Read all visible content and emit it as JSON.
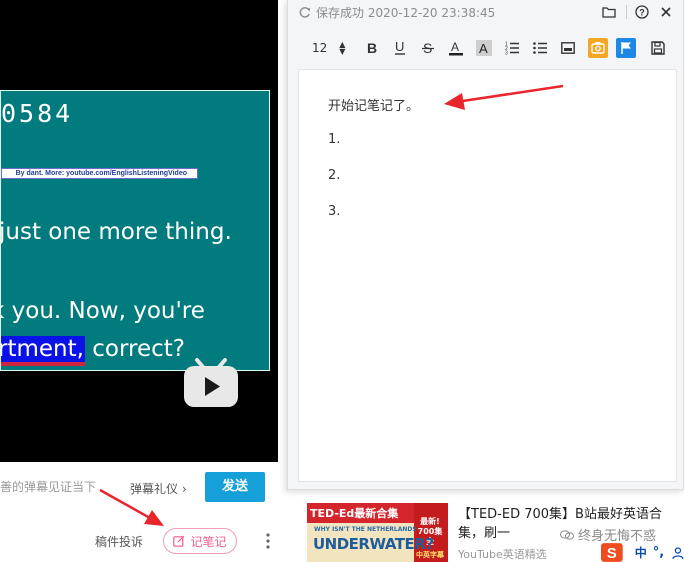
{
  "video": {
    "number": "0584",
    "credit": "By dant. More: youtube.com/EnglishListeningVideo",
    "line1": "just one more thing.",
    "line2": "k you. Now, you're",
    "line3_highlight": "rtment,",
    "line3_rest": "correct?"
  },
  "danmaku": {
    "placeholder": "善的弹幕见证当下",
    "etiquette": "弹幕礼仪",
    "send": "发送"
  },
  "toolbar": {
    "report": "稿件投诉",
    "note": "记笔记"
  },
  "note_panel": {
    "save_status": "保存成功 2020-12-20 23:38:45",
    "font_size": "12",
    "first_line": "开始记笔记了。",
    "list": [
      "1.",
      "2.",
      "3."
    ]
  },
  "recommend": {
    "thumb_title": "TED-Ed最新合集",
    "thumb_small": "WHY ISN'T THE NETHERLANDS",
    "thumb_big": "UNDERWATER?",
    "thumb_badge": "最新!\n700集全",
    "thumb_tag": "中英字幕",
    "title": "【TED-ED 700集】B站最好英语合集，刷一",
    "author": "YouTube英语精选"
  },
  "watermark": {
    "text": "终身无悔不惑"
  },
  "ime": {
    "lang": "中",
    "punct": "°,"
  },
  "colors": {
    "teal": "#017b7e",
    "send_blue": "#16a0da",
    "note_pink": "#ee5c8f",
    "arrow_red": "#e8262c",
    "camera_orange": "#f5a623",
    "flag_blue": "#1e88e5"
  },
  "icons": [
    "play-icon",
    "note-edit-icon",
    "more-icon",
    "save-status-icon",
    "folder-icon",
    "help-icon",
    "close-icon",
    "bold-icon",
    "underline-icon",
    "strikethrough-icon",
    "font-color-icon",
    "highlight-icon",
    "ordered-list-icon",
    "bullet-list-icon",
    "insert-image-icon",
    "screenshot-icon",
    "flag-icon",
    "save-icon"
  ]
}
